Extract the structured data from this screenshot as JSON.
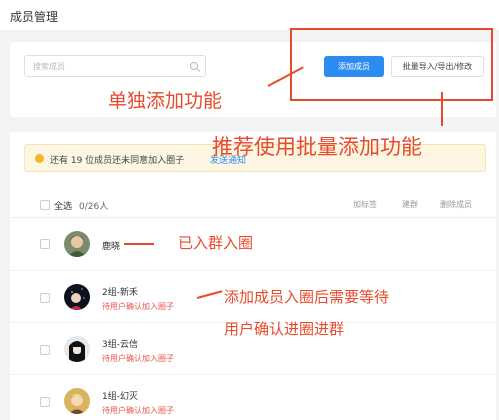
{
  "page": {
    "title": "成员管理"
  },
  "search": {
    "placeholder": "搜索成员"
  },
  "toolbar": {
    "add_label": "添加成员",
    "bulk_label": "批量导入/导出/修改"
  },
  "notice": {
    "text": "还有 19 位成员还未同意加入圈子",
    "link": "发送通知"
  },
  "list_header": {
    "select_all": "全选",
    "count": "0/26人",
    "actions": [
      "加标签",
      "建群",
      "删除成员"
    ]
  },
  "members": [
    {
      "name": "鹿晓",
      "status": ""
    },
    {
      "name": "2组-新禾",
      "status": "待用户确认加入圈子"
    },
    {
      "name": "3组-云信",
      "status": "待用户确认加入圈子"
    },
    {
      "name": "1组-幻灭",
      "status": "待用户确认加入圈子"
    }
  ],
  "annotations": {
    "single_add": "单独添加功能",
    "recommend_bulk": "推荐使用批量添加功能",
    "joined": "已入群入圈",
    "need_wait_line1": "添加成员入圈后需要等待",
    "need_wait_line2": "用户确认进圈进群"
  },
  "colors": {
    "primary": "#2d8cf0",
    "annotation": "#e84a2b",
    "pending": "#e8554e",
    "notice_bg": "#fdf6e3"
  }
}
